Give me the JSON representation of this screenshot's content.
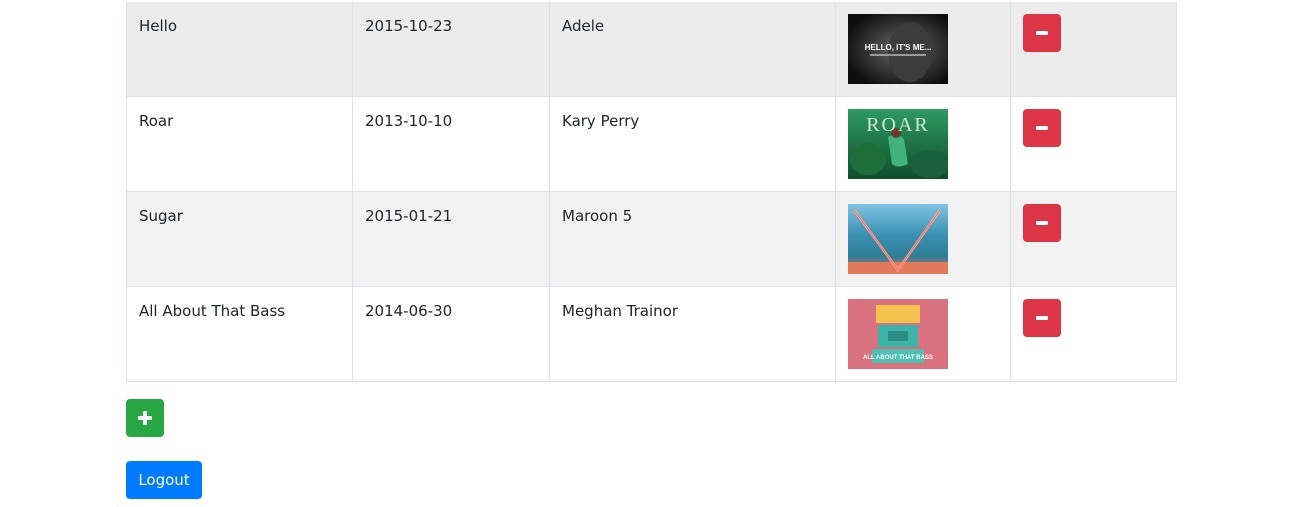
{
  "songs": [
    {
      "title": "Hello",
      "release_date": "2015-10-23",
      "artist": "Adele",
      "cover_text": "HELLO, IT'S ME...",
      "cover_theme": "grayscale"
    },
    {
      "title": "Roar",
      "release_date": "2013-10-10",
      "artist": "Kary Perry",
      "cover_text": "ROAR",
      "cover_theme": "jungle-green"
    },
    {
      "title": "Sugar",
      "release_date": "2015-01-21",
      "artist": "Maroon 5",
      "cover_text": "",
      "cover_theme": "neon-v-beach"
    },
    {
      "title": "All About That Bass",
      "release_date": "2014-06-30",
      "artist": "Meghan Trainor",
      "cover_text": "ALL ABOUT THAT BASS",
      "cover_theme": "pink-teal"
    }
  ],
  "actions": {
    "delete_icon": "minus-icon",
    "add_icon": "plus-icon",
    "logout_label": "Logout"
  },
  "colors": {
    "delete": "#dc3545",
    "add": "#28a745",
    "logout": "#007bff"
  }
}
